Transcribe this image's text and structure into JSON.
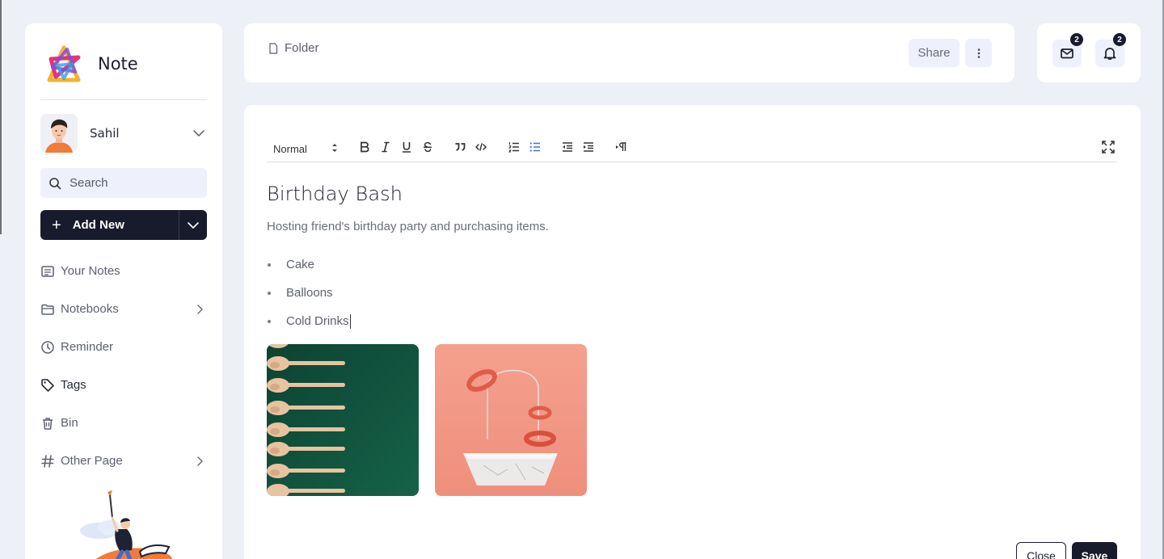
{
  "brand": {
    "name": "Note"
  },
  "user": {
    "name": "Sahil"
  },
  "search": {
    "placeholder": "Search"
  },
  "actions": {
    "add_new_label": "Add New"
  },
  "sidebar": {
    "items": [
      {
        "label": "Your Notes",
        "icon": "notes-icon"
      },
      {
        "label": "Notebooks",
        "icon": "folder-icon",
        "has_submenu": true
      },
      {
        "label": "Reminder",
        "icon": "clock-icon"
      },
      {
        "label": "Tags",
        "icon": "tag-icon",
        "active": true
      },
      {
        "label": "Bin",
        "icon": "trash-icon"
      },
      {
        "label": "Other Page",
        "icon": "hash-icon",
        "has_submenu": true
      }
    ]
  },
  "header": {
    "breadcrumb": "Folder",
    "share_label": "Share",
    "mail_count": "2",
    "notification_count": "2"
  },
  "toolbar": {
    "format_value": "Normal",
    "tools": [
      "bold",
      "italic",
      "underline",
      "strikethrough",
      "blockquote",
      "code",
      "ordered-list",
      "bullet-list",
      "outdent",
      "indent",
      "paragraph-direction",
      "fullscreen"
    ]
  },
  "note": {
    "title": "Birthday Bash",
    "description": "Hosting friend's birthday party and purchasing items.",
    "items": [
      "Cake",
      "Balloons",
      "Cold Drinks"
    ]
  },
  "footer": {
    "close_label": "Close",
    "save_label": "Save"
  },
  "colors": {
    "background": "#eef0f7",
    "primary_dark": "#181b2c",
    "accent_blue": "#3a6fd8",
    "input_bg": "#eef1fb"
  }
}
